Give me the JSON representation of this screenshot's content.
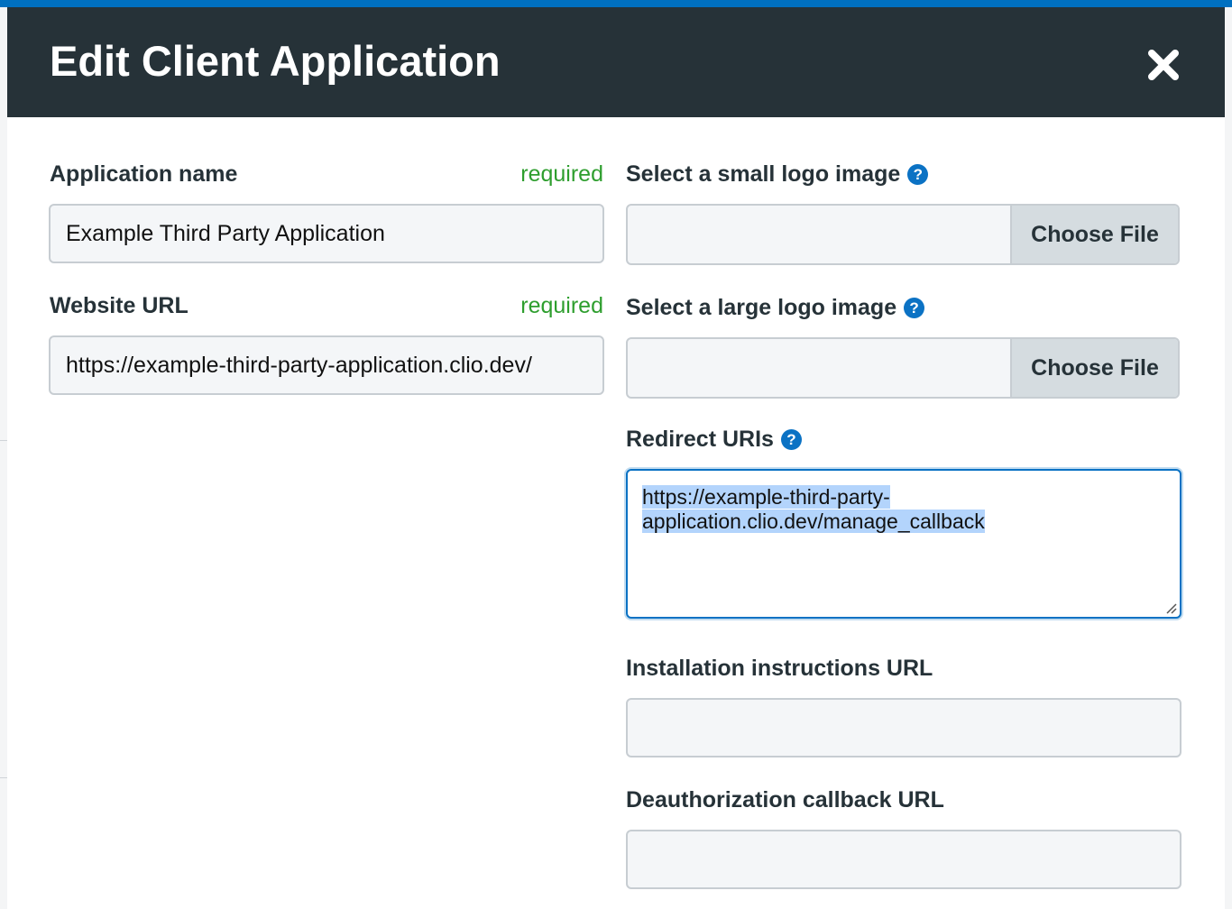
{
  "modal": {
    "title": "Edit Client Application",
    "close_icon": "close-icon"
  },
  "form": {
    "application_name": {
      "label": "Application name",
      "required_text": "required",
      "value": "Example Third Party Application"
    },
    "website_url": {
      "label": "Website URL",
      "required_text": "required",
      "value": "https://example-third-party-application.clio.dev/"
    },
    "small_logo": {
      "label": "Select a small logo image",
      "button_label": "Choose File",
      "help_icon": "question-circle-icon"
    },
    "large_logo": {
      "label": "Select a large logo image",
      "button_label": "Choose File",
      "help_icon": "question-circle-icon"
    },
    "redirect_uris": {
      "label": "Redirect URIs",
      "value_line1": "https://example-third-party-",
      "value_line2": "application.clio.dev/manage_callback",
      "help_icon": "question-circle-icon"
    },
    "installation_url": {
      "label": "Installation instructions URL",
      "value": ""
    },
    "deauthorization_url": {
      "label": "Deauthorization callback URL",
      "value": ""
    }
  },
  "colors": {
    "header_bg": "#263238",
    "accent": "#0b72c4",
    "required": "#2e9e2e",
    "top_strip": "#0070c0"
  }
}
